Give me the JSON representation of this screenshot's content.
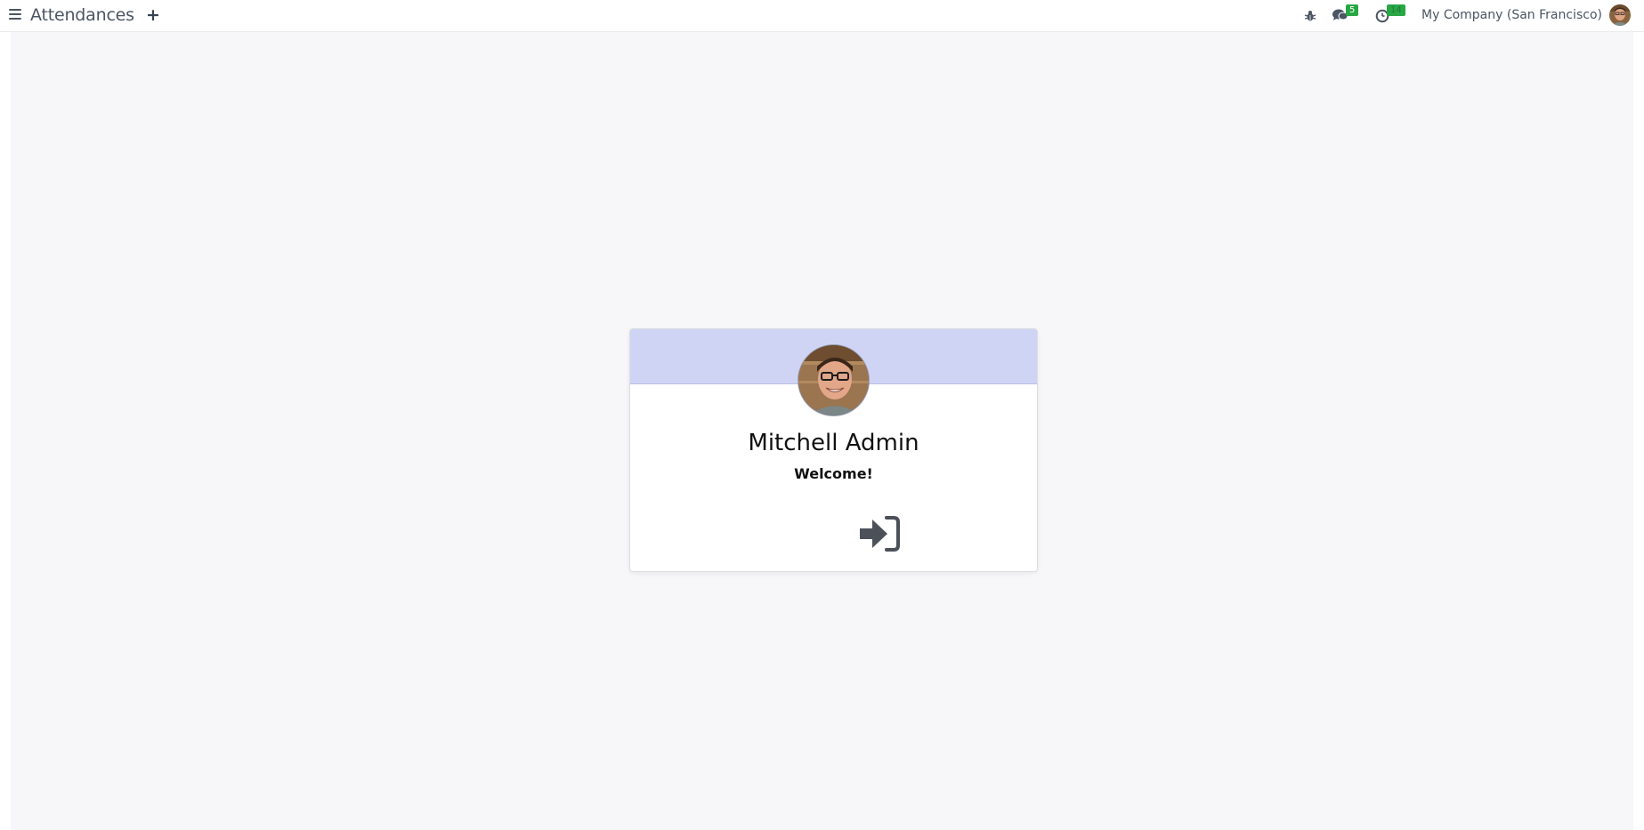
{
  "navbar": {
    "app_title": "Attendances",
    "new_label": "+",
    "messages_count": "5",
    "activities_count": "14",
    "company_name": "My Company (San Francisco)"
  },
  "card": {
    "employee_name": "Mitchell Admin",
    "greeting": "Welcome!"
  },
  "colors": {
    "card_header": "#cfd4f5",
    "badge": "#28a745",
    "background": "#f7f7f9",
    "icon": "#4b5563"
  },
  "icons": {
    "menu": "hamburger-icon",
    "debug": "bug-icon",
    "messages": "chat-bubbles-icon",
    "activities": "clock-icon",
    "checkin": "sign-in-icon"
  }
}
